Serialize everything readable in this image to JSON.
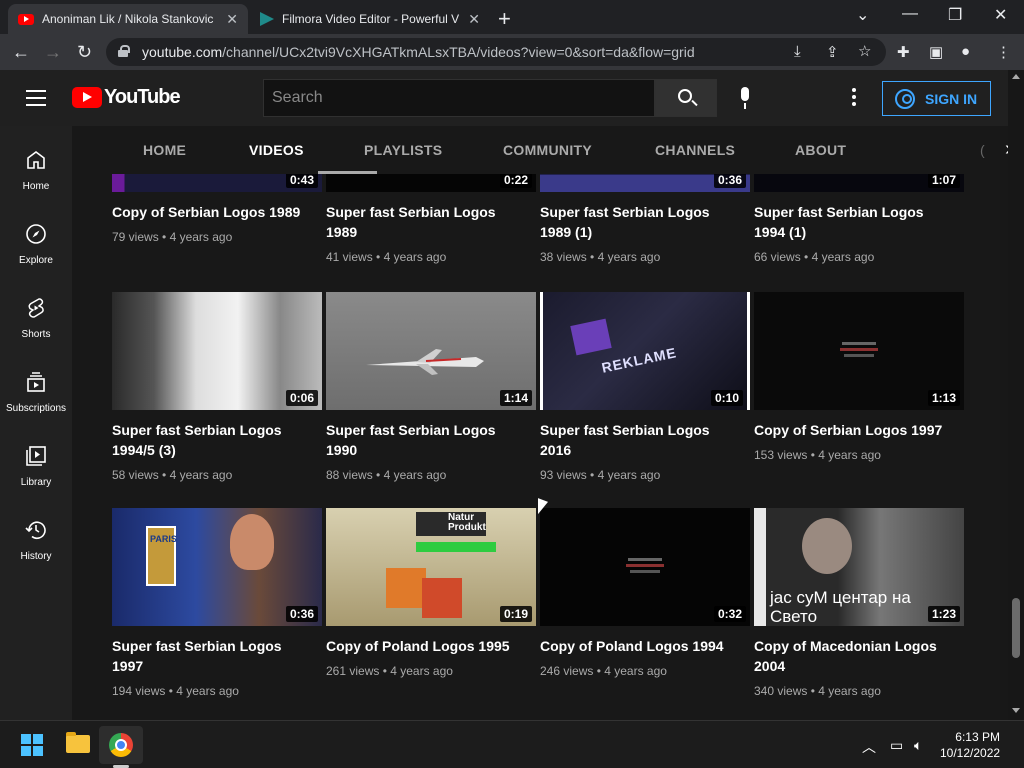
{
  "browser": {
    "tabs": [
      {
        "title": "Anoniman Lik / Nikola Stankovic",
        "active": true
      },
      {
        "title": "Filmora Video Editor - Powerful V",
        "active": false
      }
    ],
    "url_host": "youtube.com",
    "url_path": "/channel/UCx2tvi9VcXHGATkmALsxTBA/videos?view=0&sort=da&flow=grid"
  },
  "header": {
    "logo_text": "YouTube",
    "search_placeholder": "Search",
    "signin_label": "SIGN IN"
  },
  "sidebar": {
    "items": [
      {
        "label": "Home",
        "icon": "home-icon"
      },
      {
        "label": "Explore",
        "icon": "compass-icon"
      },
      {
        "label": "Shorts",
        "icon": "shorts-icon"
      },
      {
        "label": "Subscriptions",
        "icon": "subscriptions-icon"
      },
      {
        "label": "Library",
        "icon": "library-icon"
      },
      {
        "label": "History",
        "icon": "history-icon"
      }
    ]
  },
  "channel_tabs": [
    "HOME",
    "VIDEOS",
    "PLAYLISTS",
    "COMMUNITY",
    "CHANNELS",
    "ABOUT"
  ],
  "active_tab": "VIDEOS",
  "videos": [
    {
      "title": "Copy of Serbian Logos 1989",
      "views": "79 views",
      "age": "4 years ago",
      "duration": "0:43"
    },
    {
      "title": "Super fast Serbian Logos 1989",
      "views": "41 views",
      "age": "4 years ago",
      "duration": "0:22"
    },
    {
      "title": "Super fast Serbian Logos 1989 (1)",
      "views": "38 views",
      "age": "4 years ago",
      "duration": "0:36"
    },
    {
      "title": "Super fast Serbian Logos 1994 (1)",
      "views": "66 views",
      "age": "4 years ago",
      "duration": "1:07"
    },
    {
      "title": "Super fast Serbian Logos 1994/5 (3)",
      "views": "58 views",
      "age": "4 years ago",
      "duration": "0:06"
    },
    {
      "title": "Super fast Serbian Logos 1990",
      "views": "88 views",
      "age": "4 years ago",
      "duration": "1:14"
    },
    {
      "title": "Super fast Serbian Logos 2016",
      "views": "93 views",
      "age": "4 years ago",
      "duration": "0:10"
    },
    {
      "title": "Copy of Serbian Logos 1997",
      "views": "153 views",
      "age": "4 years ago",
      "duration": "1:13"
    },
    {
      "title": "Super fast Serbian Logos 1997",
      "views": "194 views",
      "age": "4 years ago",
      "duration": "0:36"
    },
    {
      "title": "Copy of Poland Logos 1995",
      "views": "261 views",
      "age": "4 years ago",
      "duration": "0:19"
    },
    {
      "title": "Copy of Poland Logos 1994",
      "views": "246 views",
      "age": "4 years ago",
      "duration": "0:32"
    },
    {
      "title": "Copy of Macedonian Logos 2004",
      "views": "340 views",
      "age": "4 years ago",
      "duration": "1:23"
    }
  ],
  "thumb_text": {
    "reklame": "REKLAME",
    "paris": "PARIS",
    "natur": "Natur Produkt",
    "mac": "јас суМ центар на Свето"
  },
  "taskbar": {
    "time": "6:13 PM",
    "date": "10/12/2022"
  },
  "colors": {
    "accent": "#3ea6ff",
    "brand_red": "#ff0000",
    "background": "#181818"
  }
}
